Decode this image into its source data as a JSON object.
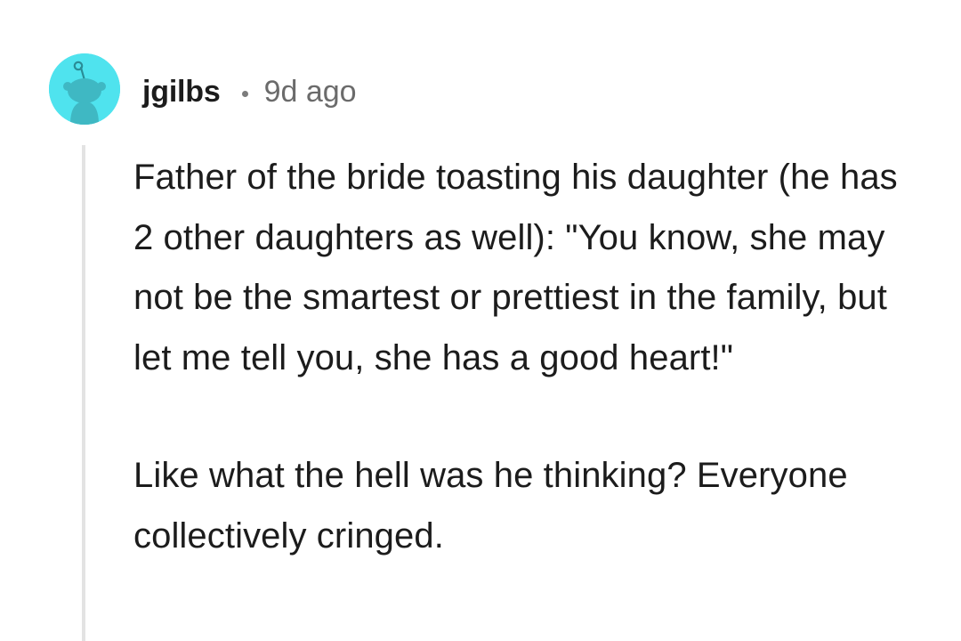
{
  "comment": {
    "username": "jgilbs",
    "timestamp": "9d ago",
    "avatar_icon": "reddit-snoo-avatar-icon",
    "avatar_bg_color": "#4fe3ee",
    "paragraphs": [
      "Father of the bride toasting his daughter (he has 2 other daughters as well): \"You know, she may not be the smartest or prettiest in the family, but let me tell you, she has a good heart!\"",
      "Like what the hell was he thinking? Everyone collectively cringed."
    ]
  }
}
